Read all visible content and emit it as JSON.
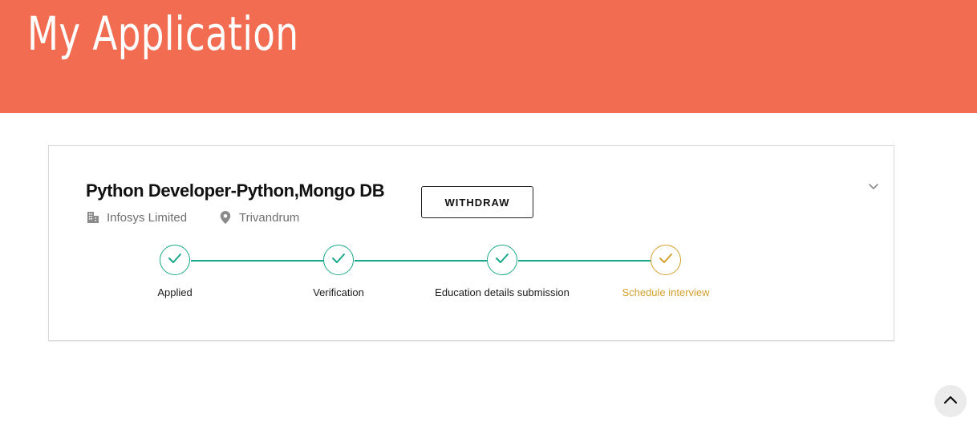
{
  "header": {
    "title": "My Application",
    "background_color": "#f26c51"
  },
  "application": {
    "job_title": "Python Developer-Python,Mongo DB",
    "company": "Infosys Limited",
    "company_icon": "building-icon",
    "location": "Trivandrum",
    "location_icon": "map-pin-icon",
    "withdraw_label": "WITHDRAW",
    "expand_icon": "chevron-down-icon"
  },
  "progress": {
    "complete_color": "#1aa88a",
    "pending_color": "#d4a02c",
    "steps": [
      {
        "label": "Applied",
        "status": "complete",
        "icon": "check-icon"
      },
      {
        "label": "Verification",
        "status": "complete",
        "icon": "check-icon"
      },
      {
        "label": "Education details submission",
        "status": "complete",
        "icon": "check-icon"
      },
      {
        "label": "Schedule interview",
        "status": "pending",
        "icon": "check-icon"
      }
    ]
  },
  "scroll_top_icon": "chevron-up-icon"
}
